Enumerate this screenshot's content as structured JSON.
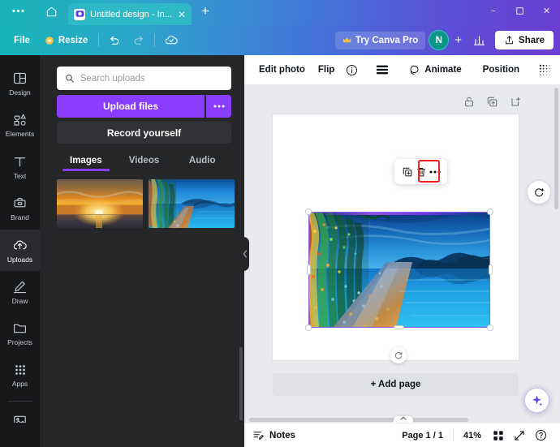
{
  "browser": {
    "menu_icon": "overflow-dots-icon",
    "home_icon": "home-icon",
    "tab_title": "Untitled design - In...",
    "tab_close": "✕",
    "new_tab": "+",
    "minimize": "−",
    "maximize": "▫",
    "close": "✕"
  },
  "toolbar": {
    "file_label": "File",
    "resize_label": "Resize",
    "undo_icon": "undo-icon",
    "redo_icon": "redo-icon",
    "cloud_icon": "cloud-saved-icon",
    "pro_label": "Try Canva Pro",
    "avatar_initial": "N",
    "add_member": "+",
    "insights_icon": "insights-chart-icon",
    "share_label": "Share"
  },
  "rail": {
    "items": [
      {
        "label": "Design",
        "icon": "design-icon",
        "active": false
      },
      {
        "label": "Elements",
        "icon": "elements-icon",
        "active": false
      },
      {
        "label": "Text",
        "icon": "text-icon",
        "active": false
      },
      {
        "label": "Brand",
        "icon": "brand-icon",
        "active": false
      },
      {
        "label": "Uploads",
        "icon": "uploads-cloud-icon",
        "active": true
      },
      {
        "label": "Draw",
        "icon": "draw-pencil-icon",
        "active": false
      },
      {
        "label": "Projects",
        "icon": "projects-folder-icon",
        "active": false
      },
      {
        "label": "Apps",
        "icon": "apps-grid-icon",
        "active": false
      },
      {
        "label": "Photos",
        "icon": "photos-icon",
        "active": false
      }
    ]
  },
  "uploads_panel": {
    "search_placeholder": "Search uploads",
    "search_value": "",
    "search_icon": "search-icon",
    "upload_button": "Upload files",
    "upload_more_icon": "overflow-dots-icon",
    "record_button": "Record yourself",
    "tabs": [
      {
        "label": "Images",
        "active": true
      },
      {
        "label": "Videos",
        "active": false
      },
      {
        "label": "Audio",
        "active": false
      }
    ],
    "thumbnails": [
      {
        "name": "sunset-over-ocean-thumbnail"
      },
      {
        "name": "blue-lake-path-thumbnail"
      }
    ],
    "collapse_icon": "chevron-left-icon"
  },
  "editor_header": {
    "edit_photo": "Edit photo",
    "flip": "Flip",
    "info_icon": "info-circle-icon",
    "lines_icon": "filter-lines-icon",
    "animate": "Animate",
    "animate_icon": "animate-icon",
    "position": "Position",
    "transparency_icon": "transparency-icon",
    "copy_style_icon": "copy-style-paint-icon",
    "lock_icon": "lock-icon"
  },
  "canvas": {
    "page_lock_icon": "lock-icon",
    "page_duplicate_icon": "duplicate-page-icon",
    "page_add_icon": "add-page-icon",
    "context_toolbar": {
      "duplicate_icon": "duplicate-icon",
      "delete_icon": "trash-delete-icon",
      "more_icon": "overflow-dots-icon",
      "highlighted": "trash-delete-icon"
    },
    "rotate_icon": "rotate-handle-icon",
    "add_page_label": "+ Add page",
    "selected_image": "blue-lake-path-image",
    "selection_color": "#8b5cf6",
    "highlight_color": "#f02020",
    "ai_assist_icon": "ai-refresh-icon",
    "magic_icon": "magic-sparkle-icon"
  },
  "statusbar": {
    "notes_label": "Notes",
    "notes_icon": "notes-icon",
    "page_indicator": "Page 1 / 1",
    "zoom_level": "41%",
    "grid_icon": "grid-view-icon",
    "fullscreen_icon": "expand-fullscreen-icon",
    "help_icon": "help-question-icon",
    "scroll_nub_icon": "chevron-up-icon"
  },
  "colors": {
    "brand_purple": "#8b3dff",
    "gradient_start": "#17b4b7",
    "gradient_end": "#6c3ed1",
    "panel_dark": "#252627",
    "rail_dark": "#17181a",
    "workspace_gray": "#e9eaee"
  }
}
